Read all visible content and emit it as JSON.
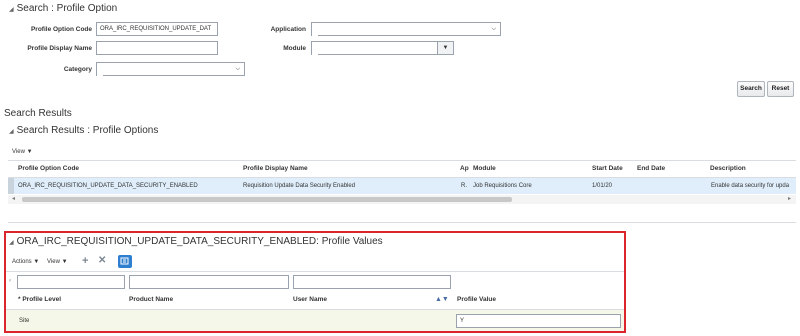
{
  "search": {
    "heading": "Search : Profile Option",
    "fields": {
      "profile_option_code": {
        "label": "Profile Option Code",
        "value": "ORA_IRC_REQUISITION_UPDATE_DAT"
      },
      "profile_display_name": {
        "label": "Profile Display Name",
        "value": ""
      },
      "category": {
        "label": "Category",
        "value": ""
      },
      "application": {
        "label": "Application",
        "value": ""
      },
      "module": {
        "label": "Module",
        "value": ""
      }
    },
    "search_button": "Search",
    "reset_button": "Reset"
  },
  "results": {
    "title": "Search Results",
    "section_heading": "Search Results : Profile Options",
    "view_menu": "View",
    "columns": [
      "Profile Option Code",
      "Profile Display Name",
      "Ap",
      "Module",
      "Start Date",
      "End Date",
      "Description"
    ],
    "rows": [
      {
        "code": "ORA_IRC_REQUISITION_UPDATE_DATA_SECURITY_ENABLED",
        "display_name": "Requisition Update Data Security Enabled",
        "ap": "R.",
        "module": "Job Requisitions Core",
        "start_date": "1/01/20",
        "end_date": "",
        "description": "Enable data security for upda"
      }
    ]
  },
  "values": {
    "heading": "ORA_IRC_REQUISITION_UPDATE_DATA_SECURITY_ENABLED: Profile Values",
    "actions_menu": "Actions",
    "view_menu": "View",
    "columns": {
      "required_mark": "*",
      "profile_level": "Profile Level",
      "product_name": "Product Name",
      "user_name": "User Name",
      "profile_value": "Profile Value"
    },
    "rows": [
      {
        "profile_level": "Site",
        "product_name": "",
        "user_name": "",
        "profile_value": "Y"
      }
    ],
    "highlight_color": "#d9252b"
  },
  "colors": {
    "selected_row": "#dfeefa",
    "value_row": "#f5f8e8",
    "accent_blue": "#2f7fd1"
  },
  "icons": [
    "collapse-triangle-icon",
    "dropdown-chevron-icon",
    "add-icon",
    "delete-icon",
    "detach-icon",
    "sort-icon",
    "filter-icon"
  ]
}
